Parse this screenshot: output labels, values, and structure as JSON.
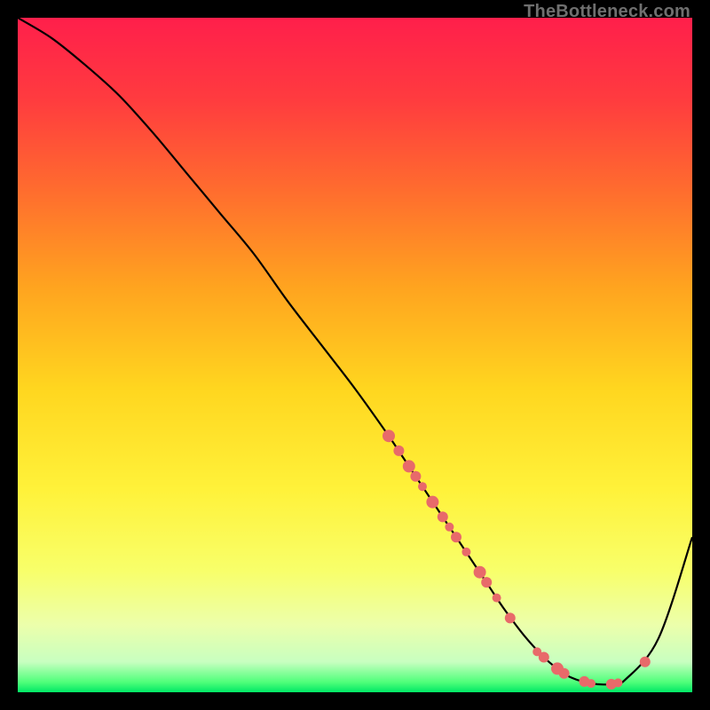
{
  "watermark": "TheBottleneck.com",
  "chart_data": {
    "type": "line",
    "title": "",
    "xlabel": "",
    "ylabel": "",
    "xlim": [
      0,
      100
    ],
    "ylim": [
      0,
      100
    ],
    "series": [
      {
        "name": "bottleneck-curve",
        "x": [
          0,
          5,
          10,
          15,
          20,
          25,
          30,
          35,
          40,
          45,
          50,
          55,
          57,
          60,
          62,
          65,
          67,
          68,
          70,
          72,
          75,
          78,
          80,
          82,
          85,
          88,
          90,
          95,
          100
        ],
        "y": [
          100,
          97,
          93,
          88.5,
          83,
          77,
          71,
          65,
          58,
          51.5,
          45,
          38,
          35,
          30.5,
          27.5,
          23,
          20,
          18.5,
          15.5,
          12.5,
          8.5,
          5.2,
          3.5,
          2.2,
          1.3,
          1.2,
          1.8,
          8,
          23
        ]
      }
    ],
    "markers": {
      "name": "highlighted-points",
      "color": "#e86a6a",
      "points": [
        {
          "x": 55,
          "y": 38,
          "r": 7
        },
        {
          "x": 56.5,
          "y": 35.8,
          "r": 6
        },
        {
          "x": 58,
          "y": 33.5,
          "r": 7
        },
        {
          "x": 59,
          "y": 32,
          "r": 6
        },
        {
          "x": 60,
          "y": 30.5,
          "r": 5
        },
        {
          "x": 61.5,
          "y": 28.2,
          "r": 7
        },
        {
          "x": 63,
          "y": 26,
          "r": 6
        },
        {
          "x": 64,
          "y": 24.5,
          "r": 5
        },
        {
          "x": 65,
          "y": 23,
          "r": 6
        },
        {
          "x": 66.5,
          "y": 20.8,
          "r": 5
        },
        {
          "x": 68.5,
          "y": 17.8,
          "r": 7
        },
        {
          "x": 69.5,
          "y": 16.3,
          "r": 6
        },
        {
          "x": 71,
          "y": 14,
          "r": 5
        },
        {
          "x": 73,
          "y": 11,
          "r": 6
        },
        {
          "x": 77,
          "y": 6,
          "r": 5
        },
        {
          "x": 78,
          "y": 5.2,
          "r": 6
        },
        {
          "x": 80,
          "y": 3.5,
          "r": 7
        },
        {
          "x": 81,
          "y": 2.8,
          "r": 6
        },
        {
          "x": 84,
          "y": 1.6,
          "r": 6
        },
        {
          "x": 85,
          "y": 1.3,
          "r": 5
        },
        {
          "x": 88,
          "y": 1.2,
          "r": 6
        },
        {
          "x": 89,
          "y": 1.4,
          "r": 5
        },
        {
          "x": 93,
          "y": 4.5,
          "r": 6
        }
      ]
    },
    "background_gradient": {
      "stops": [
        {
          "offset": 0.0,
          "color": "#ff1f4b"
        },
        {
          "offset": 0.12,
          "color": "#ff3b3f"
        },
        {
          "offset": 0.25,
          "color": "#ff6a2f"
        },
        {
          "offset": 0.4,
          "color": "#ffa41f"
        },
        {
          "offset": 0.55,
          "color": "#ffd61f"
        },
        {
          "offset": 0.7,
          "color": "#fff23a"
        },
        {
          "offset": 0.82,
          "color": "#f8ff6a"
        },
        {
          "offset": 0.9,
          "color": "#ecffab"
        },
        {
          "offset": 0.955,
          "color": "#c8ffc0"
        },
        {
          "offset": 0.985,
          "color": "#4fff7a"
        },
        {
          "offset": 1.0,
          "color": "#00e865"
        }
      ]
    }
  }
}
